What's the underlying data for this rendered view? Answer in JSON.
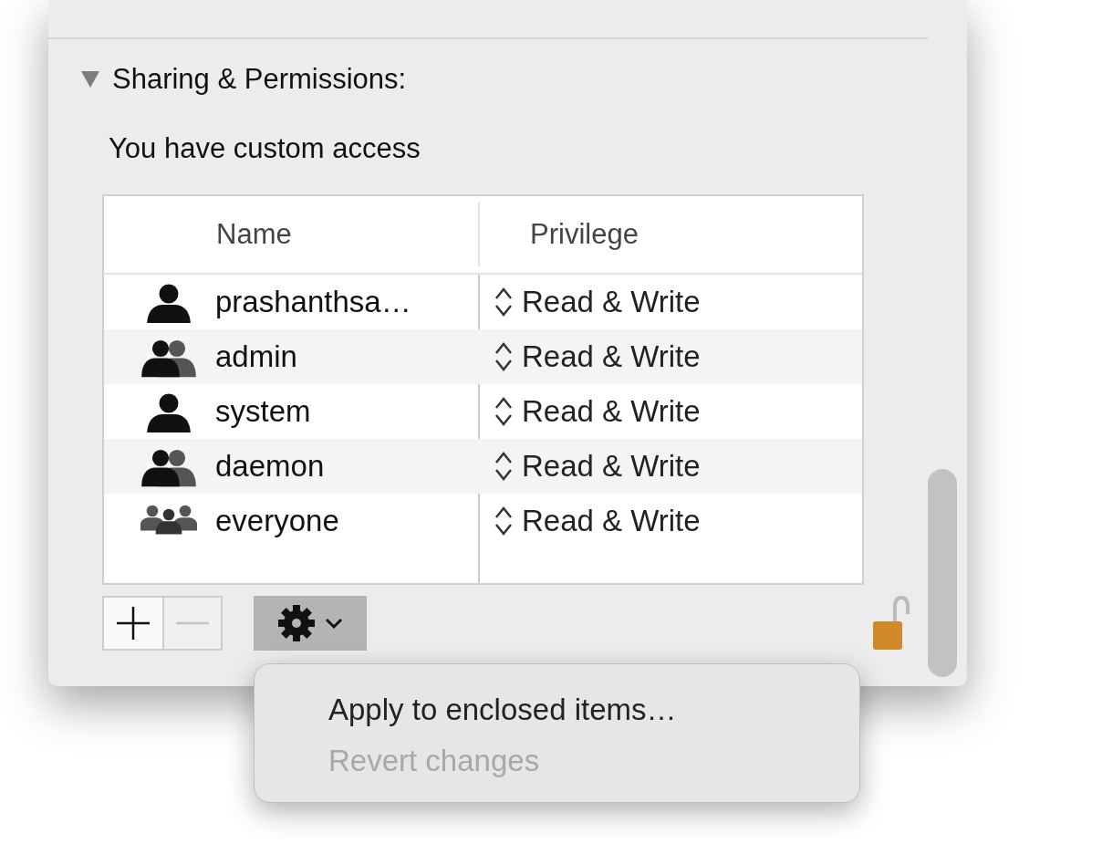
{
  "section": {
    "title": "Sharing & Permissions:",
    "expanded": true,
    "access_text": "You have custom access"
  },
  "table": {
    "columns": [
      "Name",
      "Privilege"
    ],
    "rows": [
      {
        "kind": "user",
        "name": "prashanthsa…",
        "privilege": "Read & Write"
      },
      {
        "kind": "group",
        "name": "admin",
        "privilege": "Read & Write"
      },
      {
        "kind": "user",
        "name": "system",
        "privilege": "Read & Write"
      },
      {
        "kind": "group",
        "name": "daemon",
        "privilege": "Read & Write"
      },
      {
        "kind": "everyone",
        "name": "everyone",
        "privilege": "Read & Write"
      }
    ]
  },
  "toolbar": {
    "add_disabled": false,
    "remove_disabled": true,
    "locked": false
  },
  "menu": {
    "items": [
      {
        "label": "Apply to enclosed items…",
        "disabled": false
      },
      {
        "label": "Revert changes",
        "disabled": true
      }
    ]
  }
}
